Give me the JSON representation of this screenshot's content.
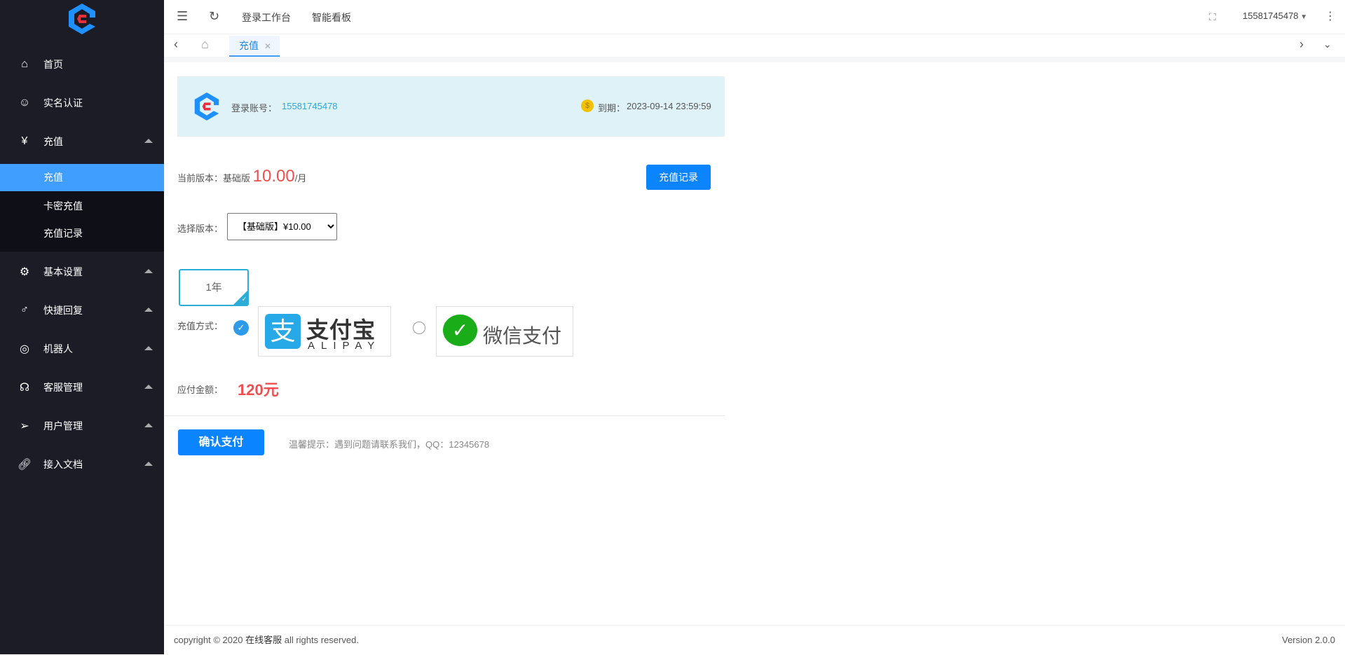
{
  "sidebar": {
    "items": [
      {
        "label": "首页",
        "icon": "home-icon"
      },
      {
        "label": "实名认证",
        "icon": "user-icon"
      },
      {
        "label": "充值",
        "icon": "yen-icon"
      },
      {
        "label": "基本设置",
        "icon": "gear-icon"
      },
      {
        "label": "快捷回复",
        "icon": "male-icon"
      },
      {
        "label": "机器人",
        "icon": "robot-icon"
      },
      {
        "label": "客服管理",
        "icon": "headset-icon"
      },
      {
        "label": "用户管理",
        "icon": "send-icon"
      },
      {
        "label": "接入文档",
        "icon": "link-icon"
      }
    ],
    "submenu": [
      "充值",
      "卡密充值",
      "充值记录"
    ]
  },
  "header": {
    "links": [
      "登录工作台",
      "智能看板"
    ],
    "user": "15581745478"
  },
  "tabs": {
    "active": "充值"
  },
  "banner": {
    "account_label": "登录账号：",
    "account": "15581745478",
    "expiry_label": "到期：",
    "expiry": "2023-09-14 23:59:59"
  },
  "version": {
    "label": "当前版本：",
    "name": "基础版",
    "price": "10.00",
    "unit": "/月",
    "records_button": "充值记录"
  },
  "select": {
    "label": "选择版本：",
    "value": "【基础版】¥10.00"
  },
  "duration": {
    "option": "1年"
  },
  "payment": {
    "label": "充值方式：",
    "alipay_cn": "支付宝",
    "alipay_en": "ALIPAY",
    "wechat": "微信支付"
  },
  "amount": {
    "label": "应付金额：",
    "value": "120元"
  },
  "confirm": {
    "button": "确认支付",
    "tip": "温馨提示：遇到问题请联系我们，QQ：12345678"
  },
  "footer": {
    "copyright": "copyright © 2020 ",
    "brand": "在线客服",
    "rights": " all rights reserved.",
    "version": "Version 2.0.0"
  }
}
